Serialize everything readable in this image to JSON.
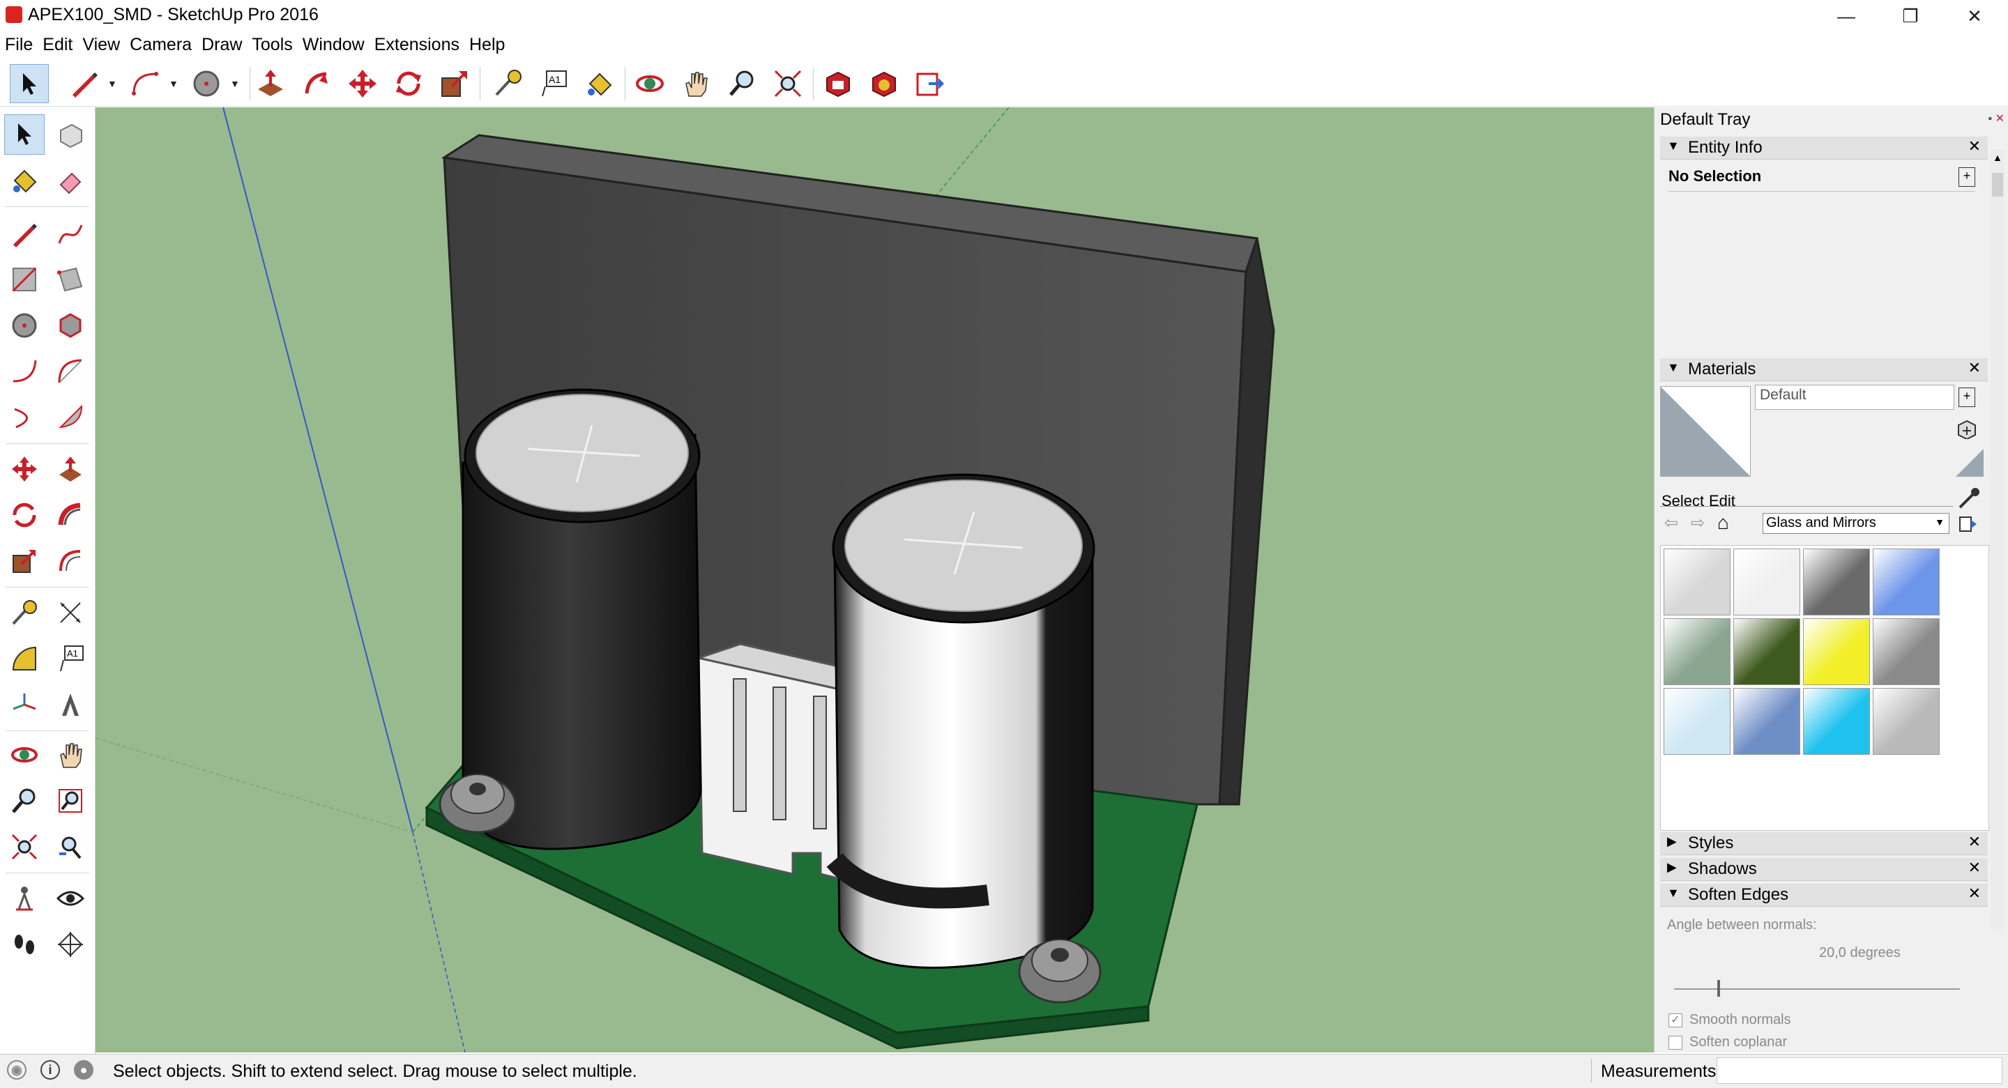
{
  "window": {
    "title": "APEX100_SMD - SketchUp Pro 2016",
    "minimize": "—",
    "restore": "❐",
    "close": "✕"
  },
  "menu": [
    "File",
    "Edit",
    "View",
    "Camera",
    "Draw",
    "Tools",
    "Window",
    "Extensions",
    "Help"
  ],
  "toolbar": {
    "tools": [
      "select",
      "line",
      "arc",
      "circle",
      "push-pull",
      "follow-me",
      "move",
      "rotate",
      "scale",
      "tape-measure",
      "text",
      "paint-bucket",
      "orbit",
      "pan",
      "zoom",
      "zoom-extents",
      "3d-warehouse",
      "extension-warehouse",
      "send-to-layout"
    ]
  },
  "left_palette": {
    "tools": [
      "select",
      "make-component",
      "paint-bucket",
      "eraser",
      "line",
      "freehand",
      "rectangle",
      "rotated-rectangle",
      "circle",
      "polygon",
      "arc",
      "two-point-arc",
      "three-point-arc",
      "pie",
      "move",
      "push-pull",
      "rotate",
      "follow-me",
      "scale",
      "offset",
      "tape-measure",
      "dimension",
      "protractor",
      "text",
      "axes",
      "3d-text",
      "orbit",
      "pan",
      "zoom",
      "zoom-window",
      "zoom-extents",
      "previous-view",
      "position-camera",
      "look-around",
      "walk",
      "section-plane"
    ],
    "text_tool_label": "A1"
  },
  "tray": {
    "title": "Default Tray",
    "entity_info": {
      "header": "Entity Info",
      "selection": "No Selection"
    },
    "materials": {
      "header": "Materials",
      "material_name": "Default",
      "tab_select": "Select",
      "tab_edit": "Edit",
      "library": "Glass and Mirrors",
      "swatch_colors": [
        [
          "#d7d7d7",
          "#f0f0f0",
          "#6a6a6a",
          "#6d95e8"
        ],
        [
          "#8aa690",
          "#3f5a1e",
          "#f2ef2a",
          "#8a8a8a"
        ],
        [
          "#cfe8f4",
          "#6e8ec6",
          "#1fc2ee",
          "#b9b9b9"
        ]
      ]
    },
    "styles_header": "Styles",
    "shadows_header": "Shadows",
    "soften_edges": {
      "header": "Soften Edges",
      "angle_label": "Angle between normals:",
      "angle_value": "20,0  degrees",
      "slider_fraction": 0.15,
      "smooth_normals": "Smooth normals",
      "smooth_normals_checked": true,
      "soften_coplanar": "Soften coplanar",
      "soften_coplanar_checked": false
    }
  },
  "status": {
    "message": "Select objects. Shift to extend select. Drag mouse to select multiple.",
    "measurements_label": "Measurements"
  },
  "colors": {
    "viewport_bg": "#98ba8e",
    "pcb": "#217d3d",
    "heatsink": "#4a4a4a",
    "capacitor_body": "#1e1e1e",
    "capacitor_top": "#cfcfcf",
    "sleeve": "#f2f2f2",
    "accent": "#cde3f5"
  }
}
